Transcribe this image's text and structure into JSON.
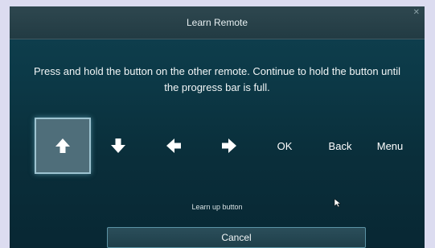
{
  "dialog": {
    "title": "Learn Remote",
    "instruction": "Press and hold the button on the other remote. Continue to hold the button until the progress bar is full.",
    "status": "Learn up button",
    "cancel_label": "Cancel"
  },
  "remote_buttons": [
    {
      "icon": "arrow-up-icon",
      "selected": true
    },
    {
      "icon": "arrow-down-icon",
      "selected": false
    },
    {
      "icon": "arrow-left-icon",
      "selected": false
    },
    {
      "icon": "arrow-right-icon",
      "selected": false
    },
    {
      "label": "OK"
    },
    {
      "label": "Back"
    },
    {
      "label": "Menu"
    }
  ],
  "colors": {
    "selected_border": "#9dc3d0",
    "dialog_bg": "#0c3947",
    "button_border": "#5c93a5"
  }
}
